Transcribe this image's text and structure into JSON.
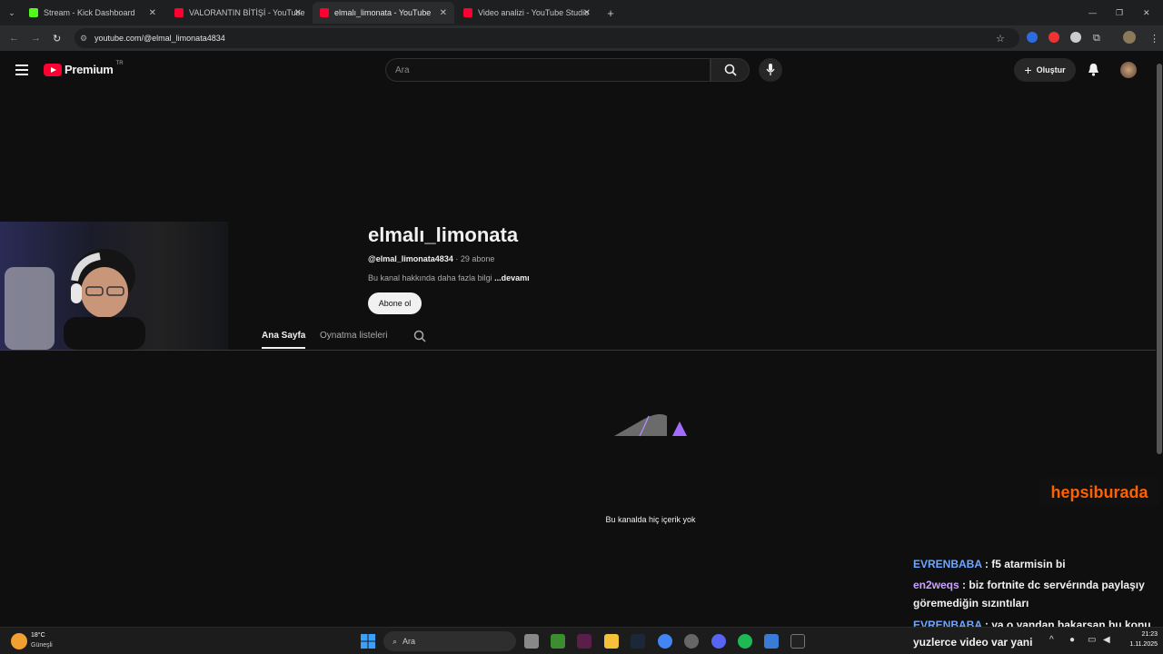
{
  "browser": {
    "tabs": [
      {
        "label": "Stream - Kick Dashboard",
        "color": "#53fc18"
      },
      {
        "label": "VALORANTIN BİTİŞİ - YouTube",
        "color": "#ff0033"
      },
      {
        "label": "elmalı_limonata - YouTube",
        "color": "#ff0033"
      },
      {
        "label": "Video analizi - YouTube Studio",
        "color": "#ff0033"
      }
    ],
    "url": "youtube.com/@elmal_limonata4834"
  },
  "youtube": {
    "logo_text": "Premium",
    "region": "TR",
    "search_placeholder": "Ara",
    "create_label": "Oluştur"
  },
  "channel": {
    "name": "elmalı_limonata",
    "handle": "@elmal_limonata4834",
    "subscribers": "· 29 abone",
    "description": "Bu kanal hakkında daha fazla bilgi",
    "more_label": "...devamı",
    "subscribe_label": "Abone ol",
    "tabs": [
      "Ana Sayfa",
      "Oynatma listeleri"
    ],
    "empty_message": "Bu kanalda hiç içerik yok"
  },
  "overlay": {
    "sponsor": "hepsiburada",
    "chat": [
      {
        "user": "EVRENBABA",
        "message": ": f5 atarmisin bi"
      },
      {
        "user": "en2weqs",
        "message": ": biz fortnite dc servérında paylaşıy"
      },
      {
        "user": "",
        "message": "göremediğin sızıntıları"
      },
      {
        "user": "EVRENBABA",
        "message": ": ya o yandan bakarsan bu konu"
      },
      {
        "user": "",
        "message": "yuzlerce video var yani"
      }
    ]
  },
  "taskbar": {
    "weather_temp": "18°C",
    "weather_desc": "Güneşli",
    "search_placeholder": "Ara",
    "time": "21:23",
    "date": "1.11.2025"
  }
}
